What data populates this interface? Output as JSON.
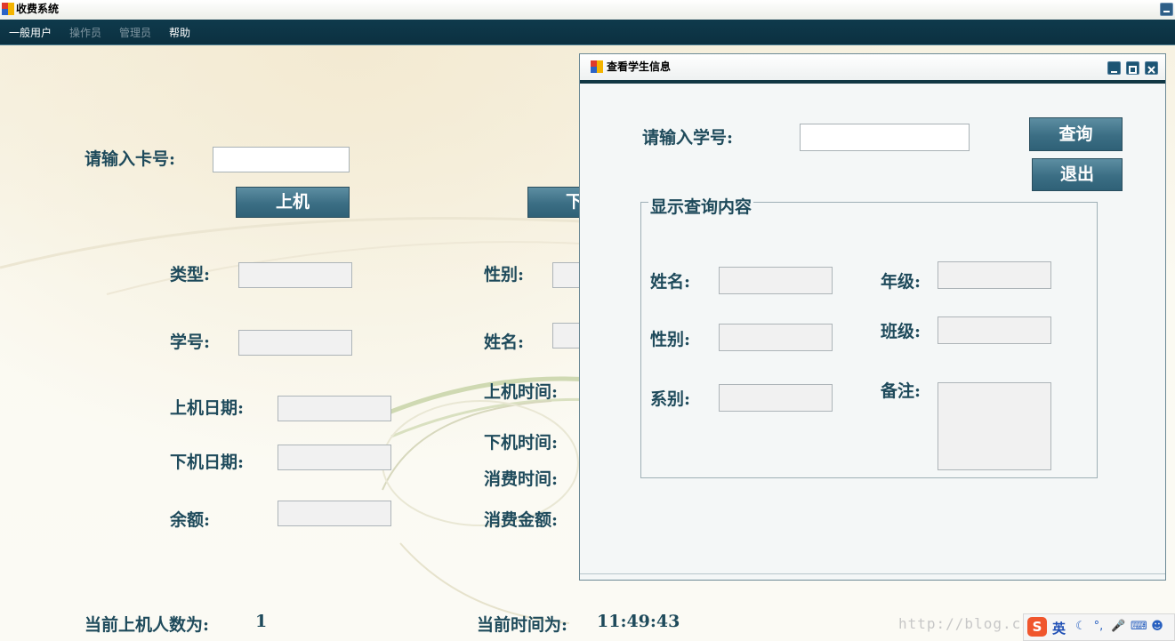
{
  "app": {
    "title": "收费系统"
  },
  "menu": {
    "items": [
      {
        "label": "一般用户",
        "enabled": true
      },
      {
        "label": "操作员",
        "enabled": false
      },
      {
        "label": "管理员",
        "enabled": false
      },
      {
        "label": "帮助",
        "enabled": true
      }
    ]
  },
  "main": {
    "card_label": "请输入卡号:",
    "card_value": "",
    "online_button": "上机",
    "offline_button": "下",
    "type_label": "类型:",
    "gender_label": "性别:",
    "student_no_label": "学号:",
    "name_label": "姓名:",
    "online_date_label": "上机日期:",
    "online_time_label": "上机时间:",
    "offline_date_label": "下机日期:",
    "offline_time_label": "下机时间:",
    "consume_time_label": "消费时间:",
    "balance_label": "余额:",
    "consume_amount_label": "消费金额:"
  },
  "status": {
    "online_count_label": "当前上机人数为:",
    "online_count_value": "1",
    "current_time_label": "当前时间为:",
    "current_time_value": "11:49:43"
  },
  "dialog": {
    "title": "查看学生信息",
    "student_no_label": "请输入学号:",
    "student_no_value": "",
    "query_button": "查询",
    "exit_button": "退出",
    "group_title": "显示查询内容",
    "name_label": "姓名:",
    "grade_label": "年级:",
    "gender_label": "性别:",
    "class_label": "班级:",
    "department_label": "系别:",
    "remark_label": "备注:"
  },
  "watermark": "http://blog.csdn.net/",
  "ime": {
    "language": "英"
  },
  "colors": {
    "menubar": "#0f3a4c",
    "label_text": "#1e4a5b",
    "button": "#3b6e84"
  }
}
